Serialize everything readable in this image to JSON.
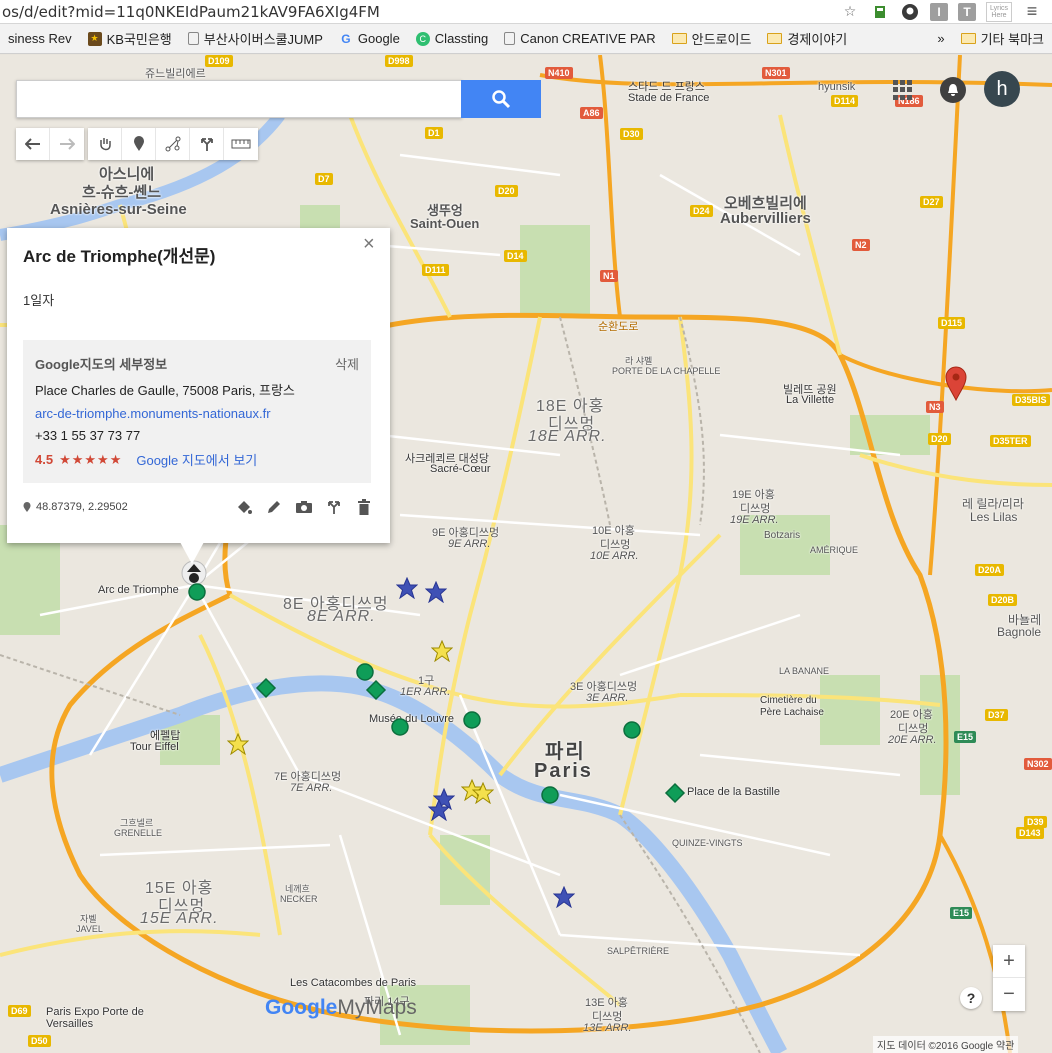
{
  "browser": {
    "url": "os/d/edit?mid=11q0NKEIdPaum21kAV9FA6XIg4FM",
    "extensions": [
      "star-icon",
      "ext-green",
      "ext-ghostery",
      "I",
      "T",
      "Lyrics Here",
      "menu-icon"
    ],
    "lyrics_label": "Lyrics Here"
  },
  "bookmarks": {
    "items": [
      {
        "label": "siness Rev"
      },
      {
        "label": "KB국민은행"
      },
      {
        "label": "부산사이버스쿨JUMP"
      },
      {
        "label": "Google"
      },
      {
        "label": "Classting"
      },
      {
        "label": "Canon CREATIVE PAR"
      },
      {
        "label": "안드로이드"
      },
      {
        "label": "경제이야기"
      }
    ],
    "more": "»",
    "other": "기타 북마크"
  },
  "map": {
    "search_placeholder": "",
    "avatar_letter": "h",
    "labels": {
      "asnieres_kr": "아스니에",
      "asnieres_kr2": "흐-슈흐-쎈느",
      "asnieres": "Asnières-sur-Seine",
      "saint_ouen_kr": "생뚜엉",
      "saint_ouen": "Saint-Ouen",
      "aubervilliers_kr": "오베흐빌리에",
      "aubervilliers": "Aubervilliers",
      "stade_kr": "스타드 드 프랑스",
      "stade": "Stade de France",
      "hyunsik": "hyunsik",
      "arr18_kr": "18E 아홍",
      "arr18_kr2": "디쓰멍",
      "arr18": "18E ARR.",
      "arr19_kr": "19E 아홍",
      "arr19_kr2": "디쓰멍",
      "arr19": "19E ARR.",
      "arr10_kr": "10E 아홍",
      "arr10_kr2": "디쓰멍",
      "arr10": "10E ARR.",
      "arr9_kr": "9E 아홍디쓰멍",
      "arr9": "9E ARR.",
      "arr8_kr": "8E 아홍디쓰멍",
      "arr8": "8E ARR.",
      "arr1_kr": "1구",
      "arr1": "1ER ARR.",
      "arr3_kr": "3E 아홍디쓰멍",
      "arr3": "3E ARR.",
      "arr7_kr": "7E 아홍디쓰멍",
      "arr7": "7E ARR.",
      "arr15_kr": "15E 아홍",
      "arr15_kr2": "디쓰멍",
      "arr15": "15E ARR.",
      "arr20_kr": "20E 아홍",
      "arr20_kr2": "디쓰멍",
      "arr20": "20E ARR.",
      "arr13_kr": "13E 아홍",
      "arr13_kr2": "디쓰멍",
      "arr13": "13E ARR.",
      "arr14_kr": "파리 14구",
      "paris_kr": "파리",
      "paris": "Paris",
      "lilas_kr": "레 릴라/리라",
      "lilas": "Les Lilas",
      "bagnolet_kr": "바뇰레",
      "bagnolet": "Bagnole",
      "villette_kr": "빌레뜨 공원",
      "villette": "La Villette",
      "sacre_kr": "사크레쾨르 대성당",
      "sacre": "Sacré-Cœur",
      "louvre": "Musée du Louvre",
      "eiffel_kr": "에펠탑",
      "eiffel": "Tour Eiffel",
      "bastille": "Place de la Bastille",
      "catacombes": "Les Catacombes de Paris",
      "expo": "Paris Expo Porte de Versailles",
      "lachaise": "Cimetière du Père Lachaise",
      "arc": "Arc de Triomphe",
      "chapelle_kr": "라 샤펠",
      "chapelle": "PORTE DE LA CHAPELLE",
      "grenelle_kr": "그흐넬르",
      "grenelle": "GRENELLE",
      "necker_kr": "네께흐",
      "necker": "NECKER",
      "javel_kr": "자벨",
      "javel": "JAVEL",
      "amerique": "AMÉRIQUE",
      "banane": "LA BANANE",
      "salpetriere": "SALPÊTRIÈRE",
      "quinze": "QUINZE-VINGTS",
      "botzaris": "Botzaris",
      "juvelleier": "쥬느빌리에르",
      "d998": "D998",
      "peripherique_kr": "순환도로",
      "n410": "N410",
      "a86": "A86",
      "n301": "N301",
      "d114": "D114",
      "n186": "N186",
      "n2": "N2",
      "d27": "D27",
      "d20": "D20",
      "d24": "D24",
      "d1": "D1",
      "d7": "D7",
      "d14": "D14",
      "d111": "D111",
      "n1": "N1",
      "d30": "D30",
      "d115": "D115",
      "n3": "N3",
      "d35bis": "D35BIS",
      "d35ter": "D35TER",
      "d20a": "D20A",
      "d20b": "D20B",
      "d37": "D37",
      "e15": "E15",
      "n302": "N302",
      "d39": "D39",
      "d143": "D143",
      "d69": "D69",
      "d50": "D50",
      "d109": "D109",
      "e15b": "E15"
    },
    "logo_google": "Google",
    "logo_my": "My",
    "logo_maps": "Maps",
    "attribution": "지도 데이터 ©2016 Google   약관"
  },
  "card": {
    "title": "Arc de Triomphe(개선문)",
    "description": "1일자",
    "details_header": "Google지도의 세부정보",
    "delete_label": "삭제",
    "address": "Place Charles de Gaulle, 75008 Paris, 프랑스",
    "website": "arc-de-triomphe.monuments-nationaux.fr",
    "phone": "+33 1 55 37 73 77",
    "rating": "4.5",
    "stars": "★★★★★",
    "view_in_maps": "Google 지도에서 보기",
    "coords": "48.87379, 2.29502",
    "close": "×"
  },
  "zoom": {
    "in": "+",
    "out": "−"
  },
  "help": "?",
  "colors": {
    "search_blue": "#4285f4",
    "marker_green": "#0f9d58",
    "marker_blue": "#3f51b5",
    "marker_yellow": "#f4e04d",
    "marker_red": "#db4437",
    "river": "#a8c7f0",
    "highway_orange": "#f5a623",
    "road_yellow": "#fbe47a",
    "park_green": "#c8dfb1"
  }
}
